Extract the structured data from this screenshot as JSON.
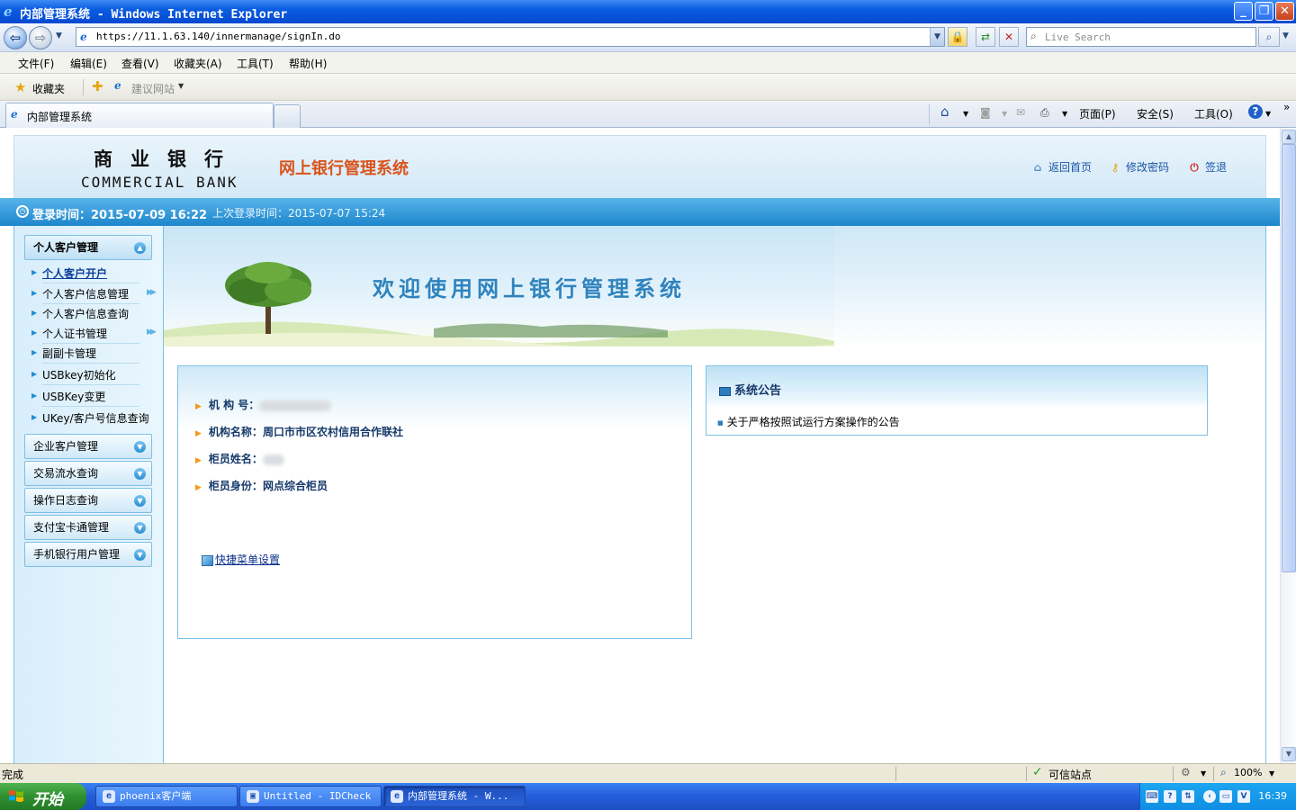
{
  "window": {
    "title": "内部管理系统 - Windows Internet Explorer",
    "controls": {
      "minimize": "_",
      "maximize": "❐",
      "close": "✕"
    }
  },
  "address": {
    "url": "https://11.1.63.140/innermanage/signIn.do",
    "search_placeholder": "Live Search"
  },
  "menu": [
    "文件(F)",
    "编辑(E)",
    "查看(V)",
    "收藏夹(A)",
    "工具(T)",
    "帮助(H)"
  ],
  "favorites": {
    "label": "收藏夹",
    "suggested": "建议网站"
  },
  "tabs": {
    "active": "内部管理系统"
  },
  "commandbar": {
    "page": "页面(P)",
    "safety": "安全(S)",
    "tools": "工具(O)",
    "help": "?"
  },
  "bank": {
    "name_cn": "商业银行",
    "name_en": "COMMERCIAL BANK",
    "system_title": "网上银行管理系统",
    "links": {
      "home": "返回首页",
      "password": "修改密码",
      "logout": "签退"
    },
    "login_time": "登录时间：2015-07-09 16:22",
    "last_login": "上次登录时间：2015-07-07 15:24",
    "welcome": "欢迎使用网上银行管理系统"
  },
  "sidebar": {
    "sections": [
      {
        "label": "个人客户管理",
        "expanded": true,
        "items": [
          {
            "label": "个人客户开户",
            "selected": true,
            "submenu": false
          },
          {
            "label": "个人客户信息管理",
            "selected": false,
            "submenu": true
          },
          {
            "label": "个人客户信息查询",
            "selected": false,
            "submenu": false
          },
          {
            "label": "个人证书管理",
            "selected": false,
            "submenu": true
          },
          {
            "label": "副副卡管理",
            "selected": false,
            "submenu": false
          },
          {
            "label": "USBkey初始化",
            "selected": false,
            "submenu": false
          },
          {
            "label": "USBKey变更",
            "selected": false,
            "submenu": false
          },
          {
            "label": "UKey/客户号信息查询",
            "selected": false,
            "submenu": false
          }
        ]
      },
      {
        "label": "企业客户管理",
        "expanded": false
      },
      {
        "label": "交易流水查询",
        "expanded": false
      },
      {
        "label": "操作日志查询",
        "expanded": false
      },
      {
        "label": "支付宝卡通管理",
        "expanded": false
      },
      {
        "label": "手机银行用户管理",
        "expanded": false
      }
    ]
  },
  "info": {
    "org_no_label": "机 构 号：",
    "org_name_label": "机构名称：",
    "org_name": "周口市市区农村信用合作联社",
    "teller_name_label": "柜员姓名：",
    "teller_role_label": "柜员身份：",
    "teller_role": "网点综合柜员",
    "quick_menu": "快捷菜单设置"
  },
  "notice": {
    "title": "系统公告",
    "items": [
      "关于严格按照试运行方案操作的公告"
    ]
  },
  "status": {
    "text": "完成",
    "zone": "可信站点",
    "zoom": "100%"
  },
  "taskbar": {
    "start": "开始",
    "tasks": [
      {
        "label": "phoenix客户端",
        "active": false
      },
      {
        "label": "Untitled - IDCheck",
        "active": false
      },
      {
        "label": "内部管理系统 - W...",
        "active": true
      }
    ],
    "clock": "16:39"
  },
  "colors": {
    "accent": "#1d86cc",
    "title_orange": "#d9541b",
    "xp_blue": "#245fdb"
  }
}
